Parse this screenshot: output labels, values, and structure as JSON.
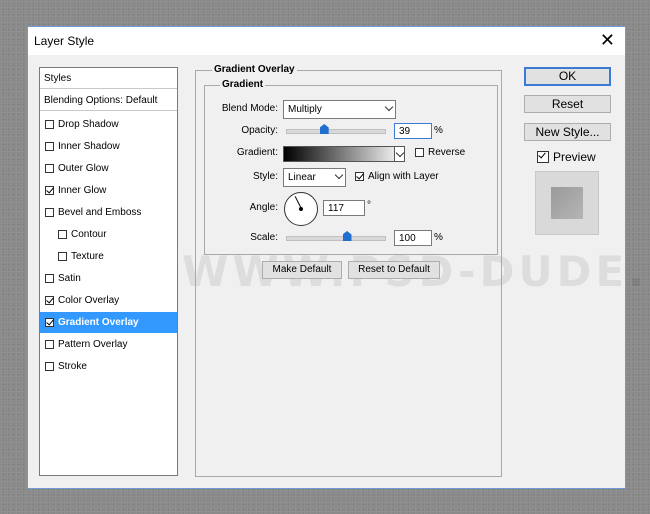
{
  "window": {
    "title": "Layer Style"
  },
  "watermark": "WWW.PSD-DUDE.com",
  "styles_list": {
    "header": "Styles",
    "blending": "Blending Options: Default",
    "items": [
      {
        "label": "Drop Shadow",
        "checked": false
      },
      {
        "label": "Inner Shadow",
        "checked": false
      },
      {
        "label": "Outer Glow",
        "checked": false
      },
      {
        "label": "Inner Glow",
        "checked": true
      },
      {
        "label": "Bevel and Emboss",
        "checked": false
      },
      {
        "label": "Contour",
        "checked": false
      },
      {
        "label": "Texture",
        "checked": false
      },
      {
        "label": "Satin",
        "checked": false
      },
      {
        "label": "Color Overlay",
        "checked": true
      },
      {
        "label": "Gradient Overlay",
        "checked": true,
        "selected": true
      },
      {
        "label": "Pattern Overlay",
        "checked": false
      },
      {
        "label": "Stroke",
        "checked": false
      }
    ]
  },
  "gradient_overlay": {
    "group_title": "Gradient Overlay",
    "sub_title": "Gradient",
    "blend_mode_label": "Blend Mode:",
    "blend_mode": "Multiply",
    "opacity_label": "Opacity:",
    "opacity": "39",
    "opacity_unit": "%",
    "opacity_fraction": 0.39,
    "gradient_label": "Gradient:",
    "reverse_label": "Reverse",
    "reverse": false,
    "style_label": "Style:",
    "style": "Linear",
    "align_label": "Align with Layer",
    "align": true,
    "angle_label": "Angle:",
    "angle": "117",
    "angle_unit": "°",
    "scale_label": "Scale:",
    "scale": "100",
    "scale_unit": "%",
    "scale_fraction": 0.5,
    "make_default": "Make Default",
    "reset_default": "Reset to Default"
  },
  "buttons": {
    "ok": "OK",
    "reset": "Reset",
    "new_style": "New Style..."
  },
  "preview": {
    "label": "Preview",
    "checked": true
  },
  "colors": {
    "accent": "#3399ff",
    "thumb": "#1f6fd1",
    "focus": "#3b7bd6"
  }
}
